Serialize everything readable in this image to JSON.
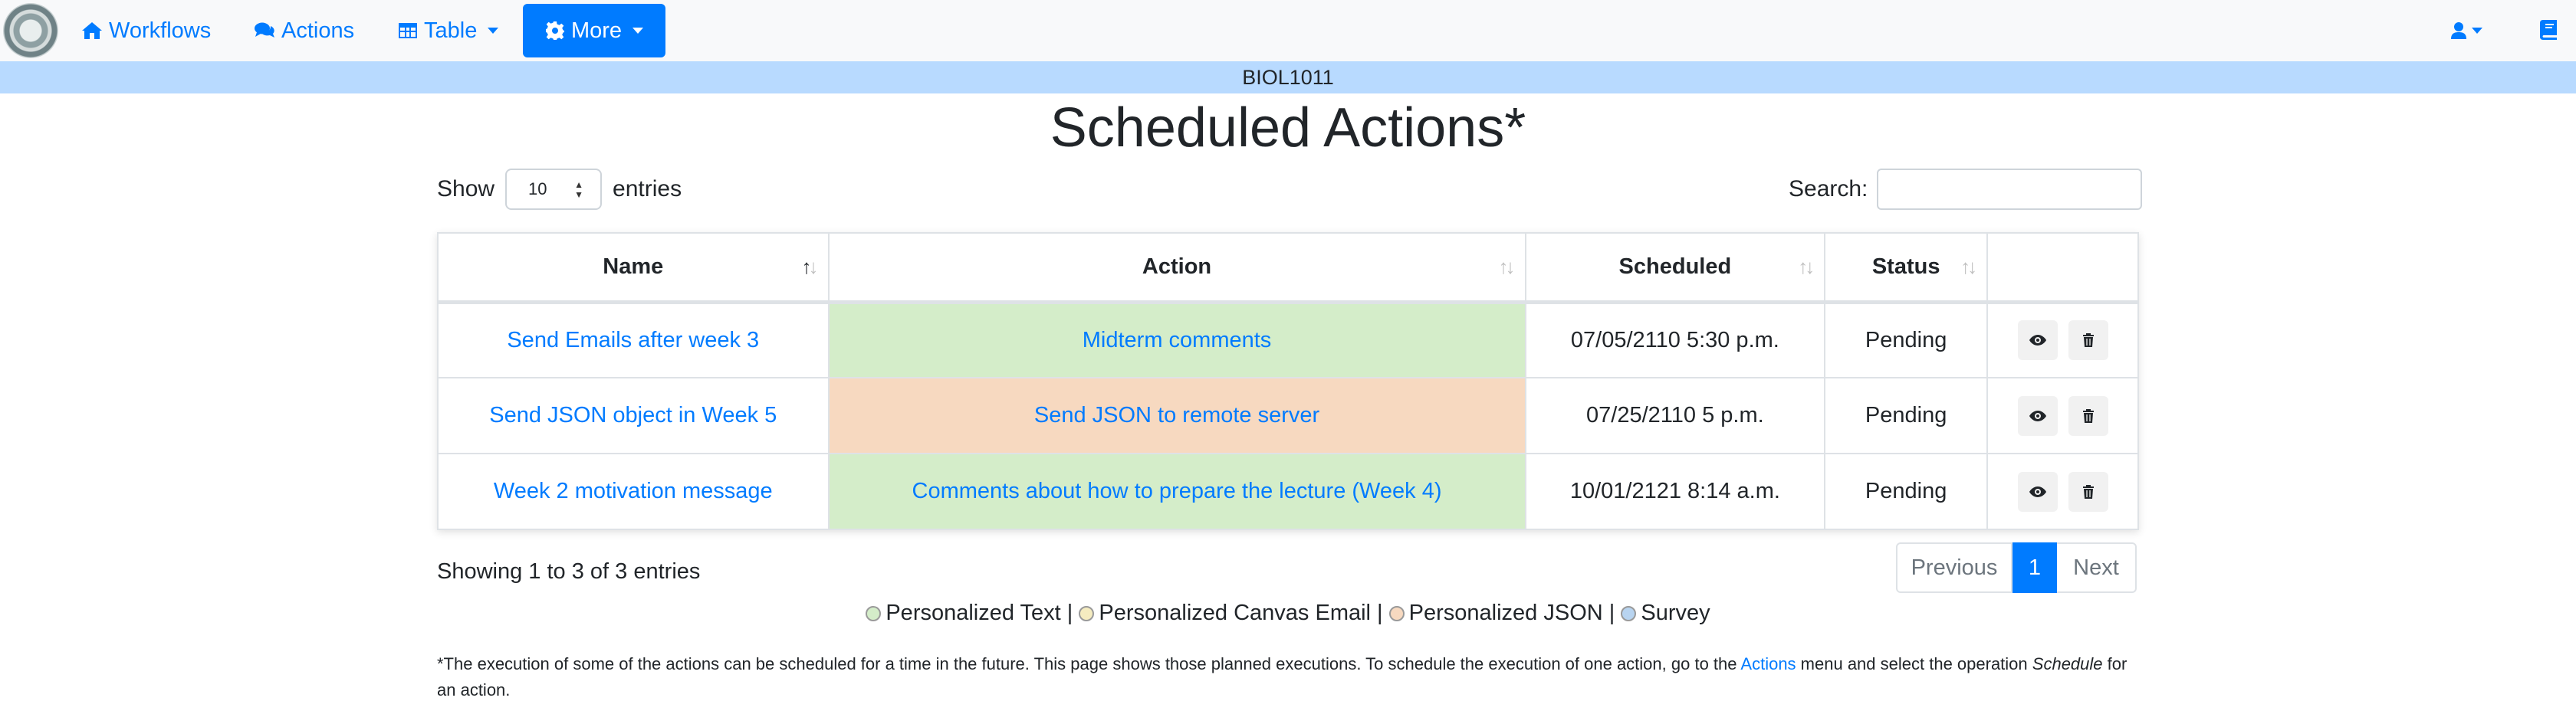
{
  "navbar": {
    "workflows": "Workflows",
    "actions": "Actions",
    "table": "Table",
    "more": "More"
  },
  "course": "BIOL1011",
  "page_title": "Scheduled Actions*",
  "controls": {
    "show": "Show",
    "entries_value": "10",
    "entries": "entries",
    "search_label": "Search:",
    "search_value": ""
  },
  "table": {
    "columns": [
      "Name",
      "Action",
      "Scheduled",
      "Status",
      ""
    ],
    "rows": [
      {
        "name": "Send Emails after week 3",
        "action": "Midterm comments",
        "action_type": "Personalized Text",
        "scheduled": "07/05/2110 5:30 p.m.",
        "status": "Pending"
      },
      {
        "name": "Send JSON object in Week 5",
        "action": "Send JSON to remote server",
        "action_type": "Personalized JSON",
        "scheduled": "07/25/2110 5 p.m.",
        "status": "Pending"
      },
      {
        "name": "Week 2 motivation message",
        "action": "Comments about how to prepare the lecture (Week 4)",
        "action_type": "Personalized Text",
        "scheduled": "10/01/2121 8:14 a.m.",
        "status": "Pending"
      }
    ]
  },
  "info": "Showing 1 to 3 of 3 entries",
  "pagination": {
    "previous": "Previous",
    "page": "1",
    "next": "Next"
  },
  "legend": [
    {
      "label": "Personalized Text",
      "color": "#d4edc9"
    },
    {
      "label": "Personalized Canvas Email",
      "color": "#f5ecc0"
    },
    {
      "label": "Personalized JSON",
      "color": "#f7d9c0"
    },
    {
      "label": "Survey",
      "color": "#b8d4f0"
    }
  ],
  "legend_separator": " | ",
  "footnote": {
    "part1": "*The execution of some of the actions can be scheduled for a time in the future. This page shows those planned executions. To schedule the execution of one action, go to the ",
    "link": "Actions",
    "part2": " menu and select the operation ",
    "emph": "Schedule",
    "part3": " for an action."
  },
  "icons": {
    "workflows": "home-icon",
    "actions": "comments-icon",
    "table": "table-icon",
    "more": "gear-icon",
    "user": "user-icon",
    "book": "book-icon",
    "view": "eye-icon",
    "delete": "trash-icon"
  },
  "colors": {
    "primary": "#007bff",
    "course_bar": "#b8daff",
    "navbar": "#f8f9fa"
  }
}
